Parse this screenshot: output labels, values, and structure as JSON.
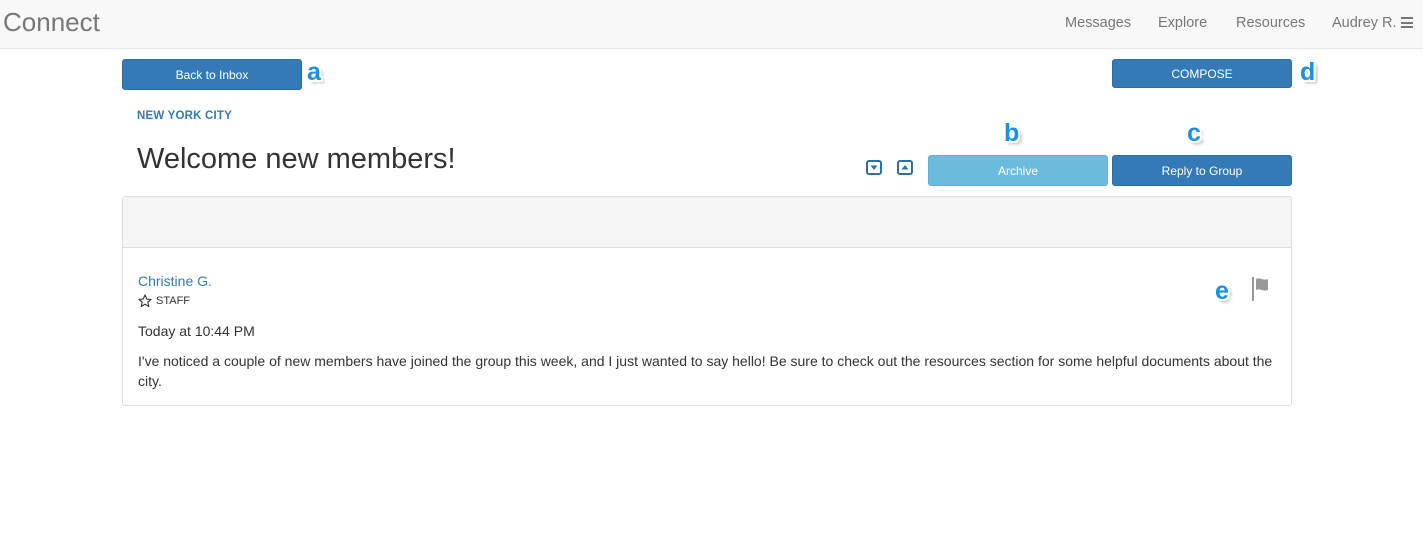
{
  "app": {
    "brand": "Connect"
  },
  "nav": {
    "messages": "Messages",
    "explore": "Explore",
    "resources": "Resources",
    "user": "Audrey R."
  },
  "toolbar": {
    "back_label": "Back to Inbox",
    "compose_label": "COMPOSE",
    "archive_label": "Archive",
    "reply_label": "Reply to Group"
  },
  "thread": {
    "group": "NEW YORK CITY",
    "title": "Welcome new members!"
  },
  "message": {
    "author": "Christine G.",
    "role": "STAFF",
    "timestamp": "Today at 10:44 PM",
    "body": "I've noticed a couple of new members have joined the group this week, and I just wanted to say hello! Be sure to check out the resources section for some helpful documents about the city."
  },
  "annotations": {
    "a": "a",
    "b": "b",
    "c": "c",
    "d": "d",
    "e": "e"
  },
  "icons": {
    "menu": "hamburger-menu-icon",
    "down": "chevron-down-icon",
    "up": "chevron-up-icon",
    "star": "star-outline-icon",
    "flag": "flag-icon"
  },
  "colors": {
    "primary": "#337ab7",
    "archive": "#6cbadc",
    "marker": "#1a8fe6"
  }
}
